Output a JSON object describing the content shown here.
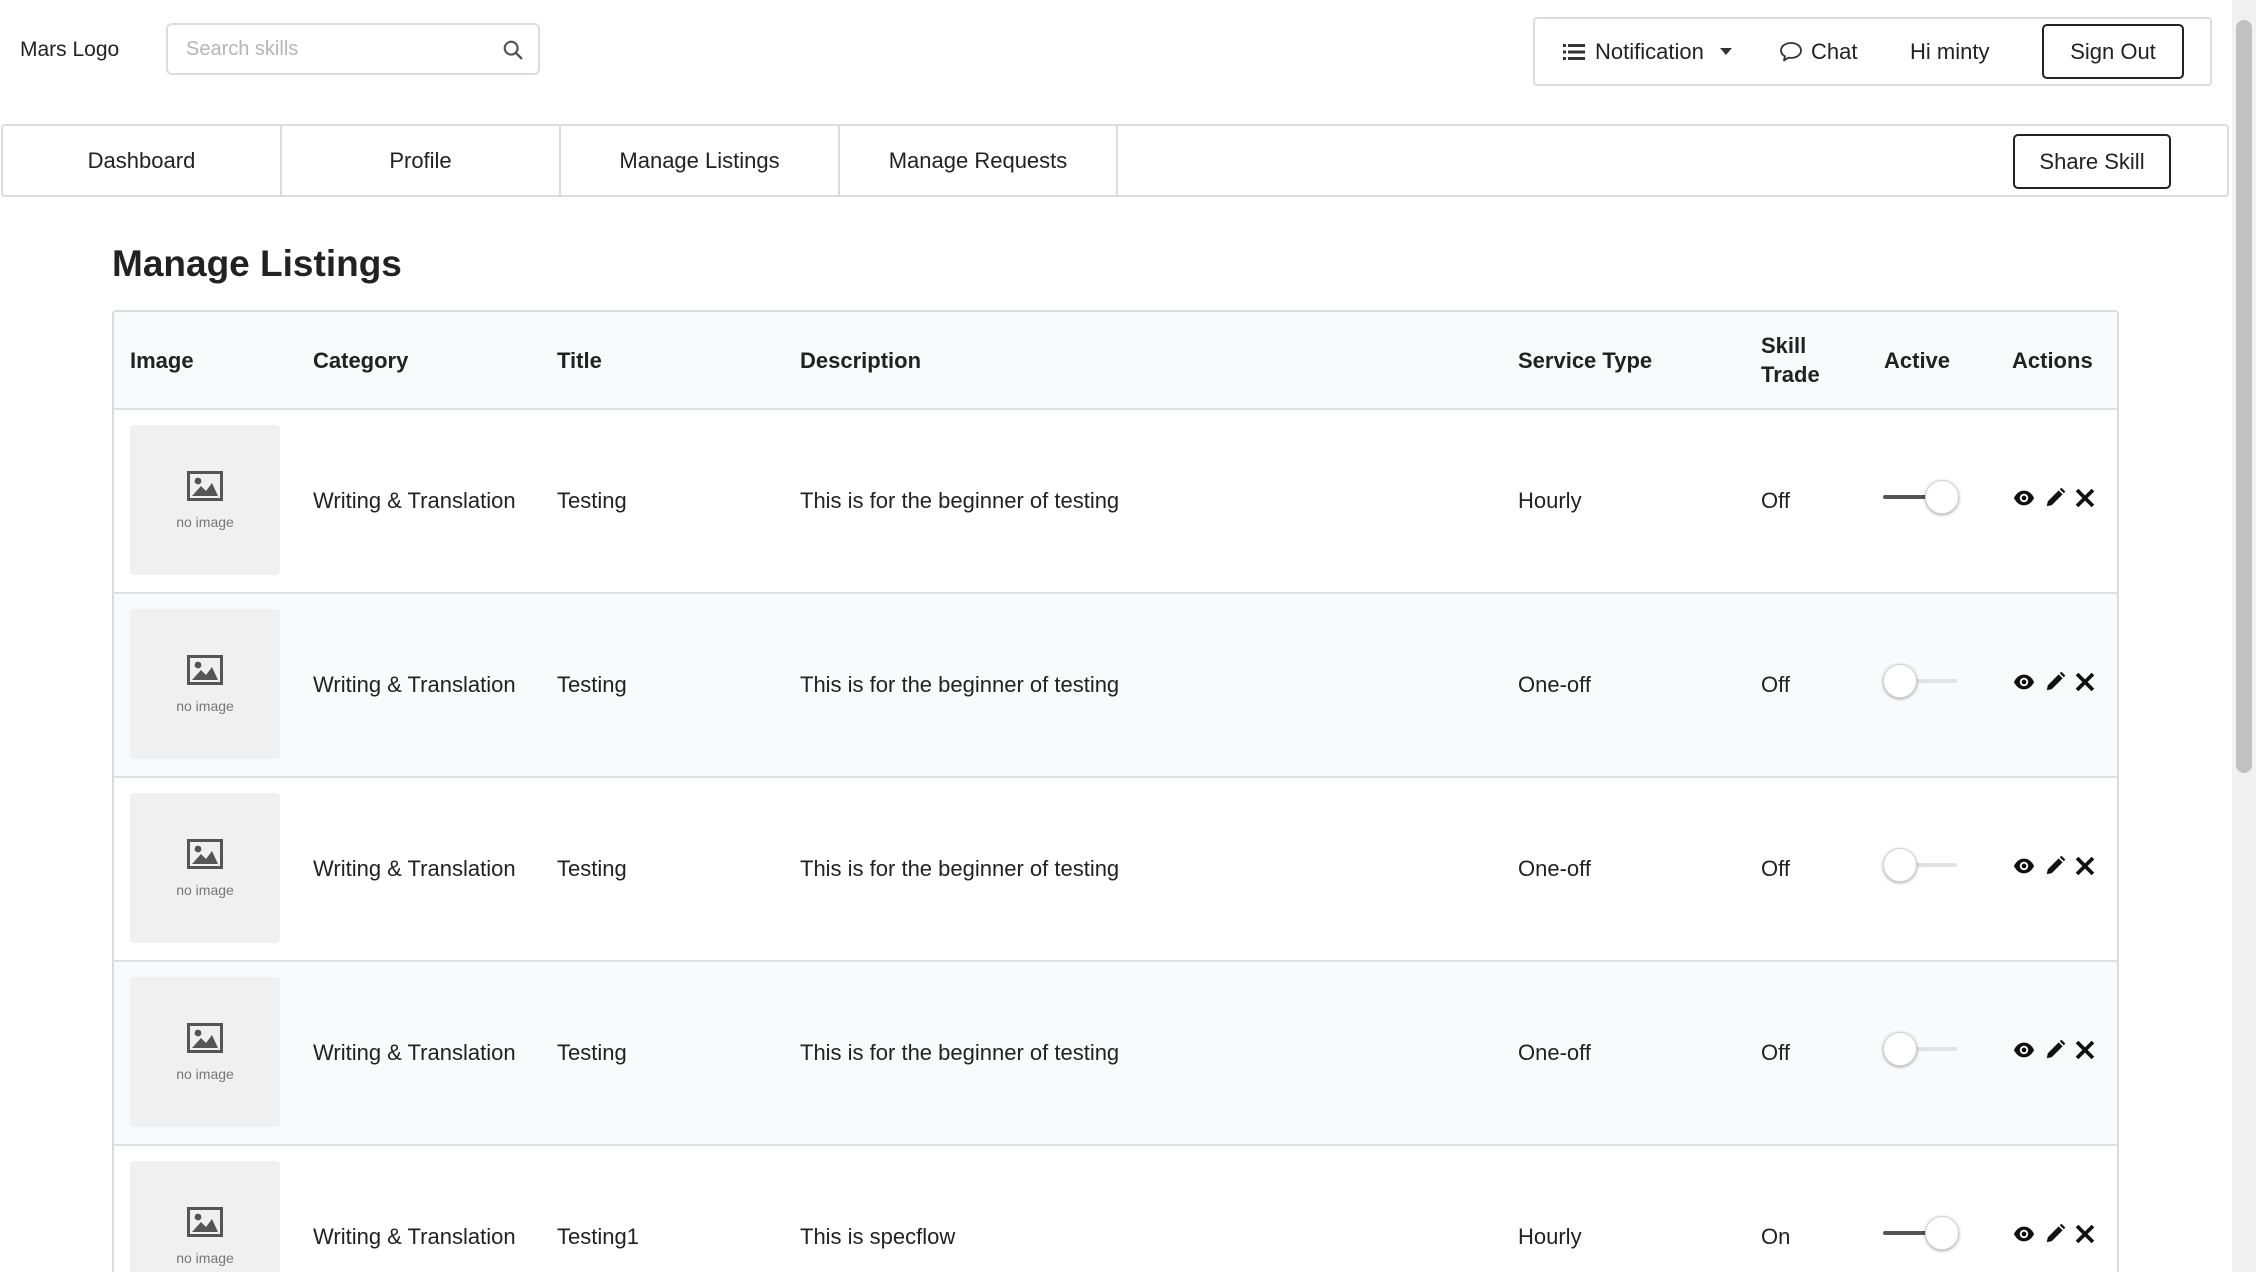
{
  "header": {
    "logo": "Mars Logo",
    "search": {
      "placeholder": "Search skills",
      "value": ""
    },
    "notification_label": "Notification",
    "chat_label": "Chat",
    "greeting": "Hi minty",
    "signout_label": "Sign Out"
  },
  "nav": {
    "tabs": [
      {
        "label": "Dashboard"
      },
      {
        "label": "Profile"
      },
      {
        "label": "Manage Listings"
      },
      {
        "label": "Manage Requests"
      }
    ],
    "share_label": "Share Skill"
  },
  "page": {
    "title": "Manage Listings"
  },
  "table": {
    "headers": {
      "image": "Image",
      "category": "Category",
      "title": "Title",
      "description": "Description",
      "service_type": "Service Type",
      "skill_trade": "Skill Trade",
      "active": "Active",
      "actions": "Actions"
    },
    "no_image_text": "no image",
    "rows": [
      {
        "category": "Writing & Translation",
        "title": "Testing",
        "description": "This is for the beginner of testing",
        "service_type": "Hourly",
        "skill_trade": "Off",
        "active": true
      },
      {
        "category": "Writing & Translation",
        "title": "Testing",
        "description": "This is for the beginner of testing",
        "service_type": "One-off",
        "skill_trade": "Off",
        "active": false
      },
      {
        "category": "Writing & Translation",
        "title": "Testing",
        "description": "This is for the beginner of testing",
        "service_type": "One-off",
        "skill_trade": "Off",
        "active": false
      },
      {
        "category": "Writing & Translation",
        "title": "Testing",
        "description": "This is for the beginner of testing",
        "service_type": "One-off",
        "skill_trade": "Off",
        "active": false
      },
      {
        "category": "Writing & Translation",
        "title": "Testing1",
        "description": "This is specflow",
        "service_type": "Hourly",
        "skill_trade": "On",
        "active": true
      }
    ]
  },
  "icons": {
    "search": "search-icon",
    "notification": "list-icon",
    "notification_caret": "caret-down-icon",
    "chat": "chat-bubble-icon",
    "no_image": "image-icon",
    "view": "eye-icon",
    "edit": "pencil-icon",
    "delete": "close-icon"
  }
}
